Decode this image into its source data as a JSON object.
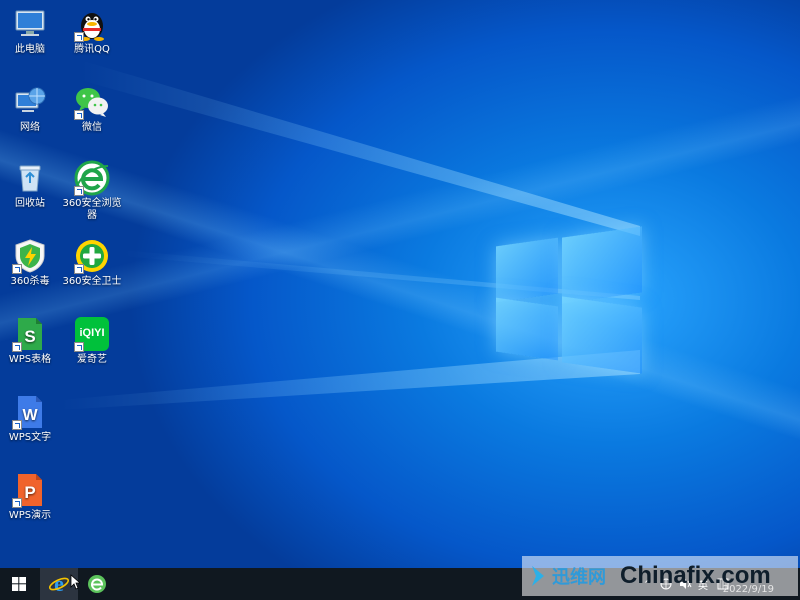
{
  "desktop": {
    "icons": [
      {
        "label": "此电脑",
        "icon": "computer-icon"
      },
      {
        "label": "腾讯QQ",
        "icon": "qq-icon"
      },
      {
        "label": "网络",
        "icon": "network-icon"
      },
      {
        "label": "微信",
        "icon": "wechat-icon"
      },
      {
        "label": "回收站",
        "icon": "recycle-bin-icon"
      },
      {
        "label": "360安全浏览器",
        "icon": "360-browser-icon"
      },
      {
        "label": "360杀毒",
        "icon": "360-antivirus-icon"
      },
      {
        "label": "360安全卫士",
        "icon": "360-security-icon"
      },
      {
        "label": "WPS表格",
        "icon": "wps-spreadsheet-icon"
      },
      {
        "label": "爱奇艺",
        "icon": "iqiyi-icon"
      },
      {
        "label": "WPS文字",
        "icon": "wps-writer-icon"
      },
      {
        "label": "WPS演示",
        "icon": "wps-presentation-icon"
      }
    ],
    "iqiyi_logo_text": "iQIYI"
  },
  "taskbar": {
    "pinned": [
      {
        "icon": "internet-explorer-icon"
      },
      {
        "icon": "360-browser-taskbar-icon"
      }
    ],
    "tray": {
      "chevron": "^",
      "ime": "英",
      "time": "10:10",
      "date": "2022/9/19"
    }
  },
  "watermark": {
    "left_text": "迅维网",
    "right_text": "Chinafix.com"
  },
  "colors": {
    "desktop_blue": "#0a7ae0",
    "taskbar": "#101820",
    "wps_green": "#2eaa4a",
    "wps_blue": "#3e7be8",
    "wps_orange": "#f0632c",
    "iqiyi_green": "#00c13b"
  }
}
